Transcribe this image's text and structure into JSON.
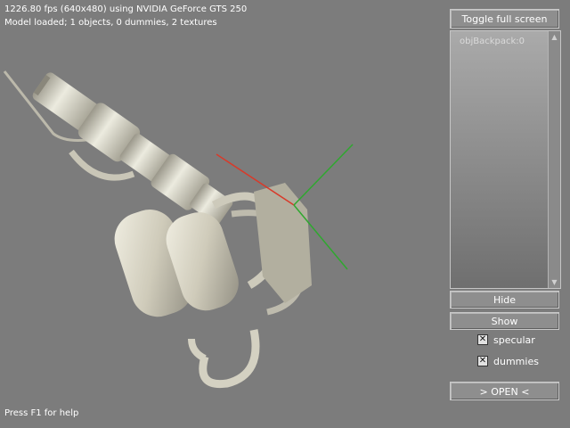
{
  "hud": {
    "fps_line": "1226.80 fps (640x480) using NVIDIA GeForce GTS 250",
    "model_line": "Model loaded; 1 objects, 0 dummies, 2 textures",
    "help_line": "Press F1 for help"
  },
  "panel": {
    "toggle_fullscreen_label": "Toggle full screen",
    "object_list": [
      "objBackpack:0"
    ],
    "scroll_up_glyph": "▲",
    "scroll_down_glyph": "▼",
    "hide_label": "Hide",
    "show_label": "Show",
    "specular_label": "specular",
    "specular_checked": true,
    "dummies_label": "dummies",
    "dummies_checked": true,
    "check_glyph": "✕",
    "open_label": "> OPEN <"
  },
  "colors": {
    "background": "#7c7c7c",
    "axis_x": "#d83a2a",
    "axis_y": "#2fa82f",
    "model": "#d9d6c6"
  }
}
